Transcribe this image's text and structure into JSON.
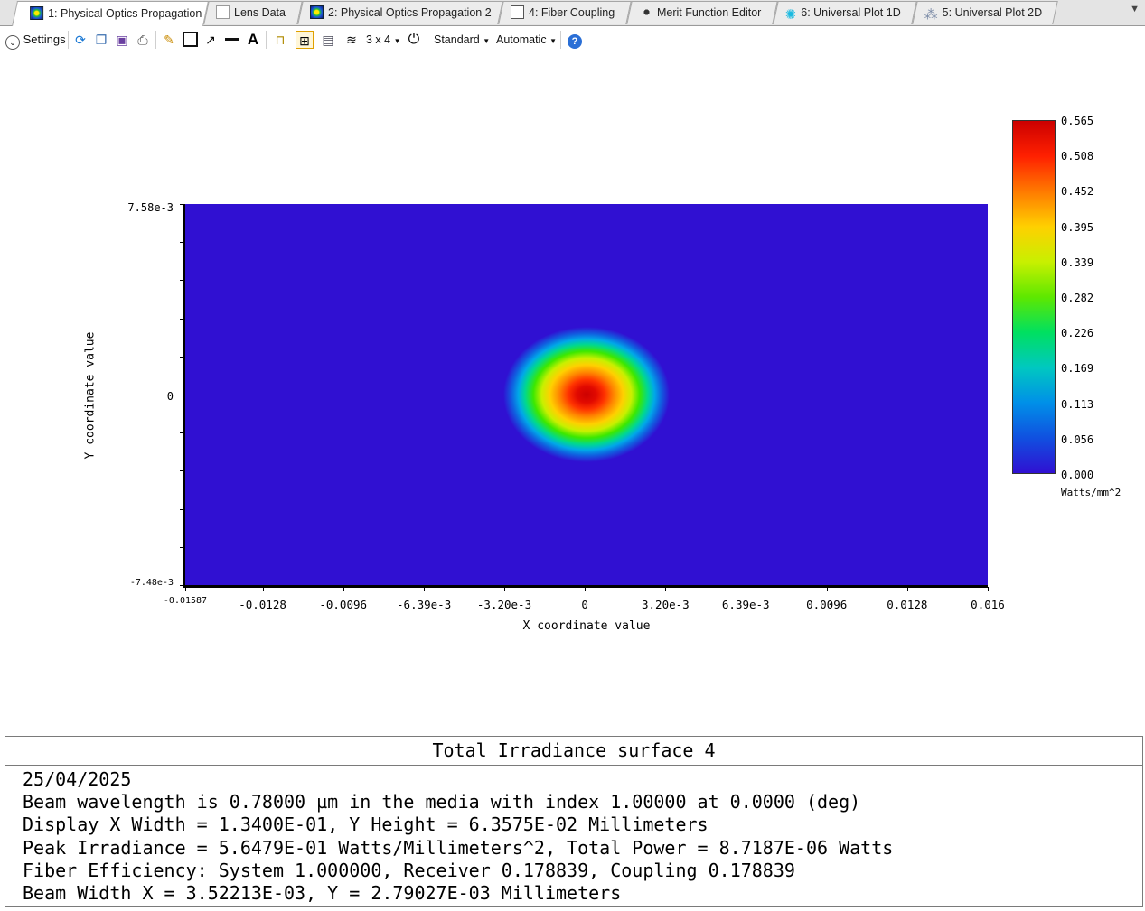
{
  "tabs": [
    {
      "label": "1: Physical Optics Propagation",
      "icon": "pop-analysis-icon",
      "active": true,
      "closable": true
    },
    {
      "label": "Lens Data",
      "icon": "document-icon"
    },
    {
      "label": "2: Physical Optics Propagation 2",
      "icon": "pop-analysis-icon"
    },
    {
      "label": "4: Fiber Coupling",
      "icon": "fiber-coupling-icon"
    },
    {
      "label": "Merit Function Editor",
      "icon": "merit-function-icon"
    },
    {
      "label": "6: Universal Plot 1D",
      "icon": "universal-plot-1d-icon"
    },
    {
      "label": "5: Universal Plot 2D",
      "icon": "universal-plot-2d-icon"
    }
  ],
  "toolbar": {
    "settings_label": "Settings",
    "layout_label": "3 x 4",
    "standard_label": "Standard",
    "automatic_label": "Automatic",
    "icons": [
      "refresh-icon",
      "copy-icon",
      "save-icon",
      "print-icon",
      "pencil-icon",
      "rectangle-icon",
      "arrow-icon",
      "line-icon",
      "text-icon",
      "lock-icon",
      "grid-icon",
      "windows-icon",
      "stack-icon",
      "power-icon",
      "help-icon"
    ]
  },
  "chart_data": {
    "type": "heatmap",
    "title": "",
    "xlabel": "X coordinate value",
    "ylabel": "Y coordinate value",
    "x_ticks": [
      "-0.01587",
      "-0.0128",
      "-0.0096",
      "-6.39e-3",
      "-3.20e-3",
      "0",
      "3.20e-3",
      "6.39e-3",
      "0.0096",
      "0.0128",
      "0.016"
    ],
    "x_tick_values": [
      -0.01587,
      -0.0128,
      -0.0096,
      -0.00639,
      -0.0032,
      0,
      0.0032,
      0.00639,
      0.0096,
      0.0128,
      0.016
    ],
    "y_ticks": [
      "7.58e-3",
      "0",
      "-7.48e-3"
    ],
    "y_tick_values": [
      0.00758,
      0,
      -0.00748
    ],
    "xlim": [
      -0.01587,
      0.016
    ],
    "ylim": [
      -0.00748,
      0.00758
    ],
    "peak": {
      "x": 0,
      "y": 0,
      "value": 0.565
    },
    "colorbar": {
      "ticks": [
        "0.565",
        "0.508",
        "0.452",
        "0.395",
        "0.339",
        "0.282",
        "0.226",
        "0.169",
        "0.113",
        "0.056",
        "0.000"
      ],
      "range": [
        0.0,
        0.565
      ],
      "unit": "Watts/mm^2",
      "colormap": [
        "#cc0000",
        "#ff7a00",
        "#ffd000",
        "#5ee800",
        "#00c8c0",
        "#1050e0",
        "#3010d2"
      ]
    },
    "background_color": "#3010d2"
  },
  "info": {
    "title": "Total Irradiance surface 4",
    "lines": [
      "25/04/2025",
      "Beam wavelength is 0.78000 µm in the media with index 1.00000 at 0.0000 (deg)",
      "Display X Width = 1.3400E-01, Y Height = 6.3575E-02 Millimeters",
      "Peak Irradiance = 5.6479E-01 Watts/Millimeters^2, Total Power = 8.7187E-06 Watts",
      "Fiber Efficiency: System 1.000000, Receiver 0.178839, Coupling 0.178839",
      "Beam Width X = 3.52213E-03, Y = 2.79027E-03 Millimeters"
    ]
  }
}
